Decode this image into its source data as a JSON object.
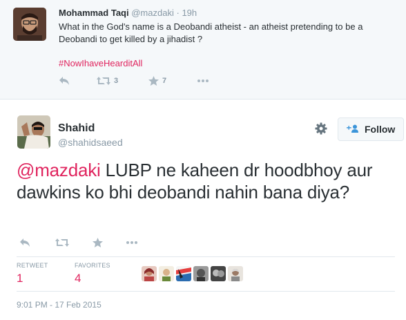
{
  "parent_tweet": {
    "name": "Mohammad Taqi",
    "handle": "@mazdaki",
    "separator": "·",
    "time": "19h",
    "text": "What in the God's name is a Deobandi atheist - an atheist pretending to be a Deobandi to get killed by a jihadist ?",
    "hashtag": "#NowIhaveHearditAll",
    "retweet_count": "3",
    "favorite_count": "7"
  },
  "main_tweet": {
    "name": "Shahid",
    "handle": "@shahidsaeed",
    "follow_label": "Follow",
    "mention": "@mazdaki",
    "text": " LUBP ne kaheen dr hoodbhoy aur dawkins ko bhi deobandi nahin bana diya?",
    "retweets_label": "RETWEET",
    "retweets_count": "1",
    "favorites_label": "FAVORITES",
    "favorites_count": "4",
    "timestamp": "9:01 PM - 17 Feb 2015"
  },
  "colors": {
    "accent": "#e0245e",
    "muted": "#8899a6",
    "icon": "#aab8c2",
    "text": "#292f33"
  },
  "icons": [
    "reply-icon",
    "retweet-icon",
    "favorite-icon",
    "more-icon",
    "gear-icon",
    "follow-person-icon"
  ]
}
